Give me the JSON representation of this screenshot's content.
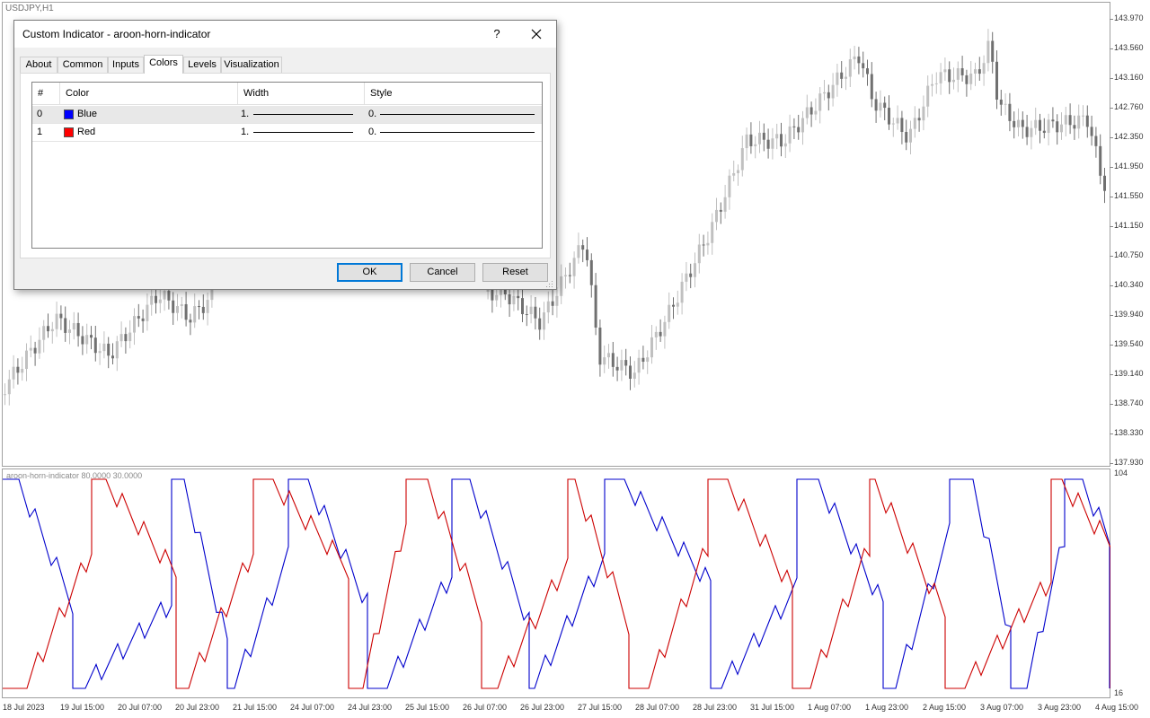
{
  "chart": {
    "symbol": "USDJPY,H1",
    "price_labels": [
      "143.970",
      "143.560",
      "143.160",
      "142.760",
      "142.350",
      "141.950",
      "141.550",
      "141.150",
      "140.750",
      "140.340",
      "139.940",
      "139.540",
      "139.140",
      "138.740",
      "138.330",
      "137.930"
    ],
    "indicator_label": "aroon-horn-indicator 80.0000 30.0000",
    "indicator_scale": [
      "104",
      "16"
    ],
    "time_labels": [
      "18 Jul 2023",
      "19 Jul 15:00",
      "20 Jul 07:00",
      "20 Jul 23:00",
      "21 Jul 15:00",
      "24 Jul 07:00",
      "24 Jul 23:00",
      "25 Jul 15:00",
      "26 Jul 07:00",
      "26 Jul 23:00",
      "27 Jul 15:00",
      "28 Jul 07:00",
      "28 Jul 23:00",
      "31 Jul 15:00",
      "1 Aug 07:00",
      "1 Aug 23:00",
      "2 Aug 15:00",
      "3 Aug 07:00",
      "3 Aug 23:00",
      "4 Aug 15:00"
    ],
    "colors": {
      "up_candle": "#c0c0c0",
      "down_candle": "#707070",
      "aroon_up": "#0000cc",
      "aroon_down": "#cc0000"
    }
  },
  "dialog": {
    "title": "Custom Indicator - aroon-horn-indicator",
    "help": "?",
    "tabs": [
      "About",
      "Common",
      "Inputs",
      "Colors",
      "Levels",
      "Visualization"
    ],
    "active_tab": "Colors",
    "columns": [
      "#",
      "Color",
      "Width",
      "Style"
    ],
    "rows": [
      {
        "index": "0",
        "color_name": "Blue",
        "color": "#0000ff",
        "width": "1.",
        "style": "0."
      },
      {
        "index": "1",
        "color_name": "Red",
        "color": "#ff0000",
        "width": "1.",
        "style": "0."
      }
    ],
    "buttons": {
      "ok": "OK",
      "cancel": "Cancel",
      "reset": "Reset"
    }
  }
}
